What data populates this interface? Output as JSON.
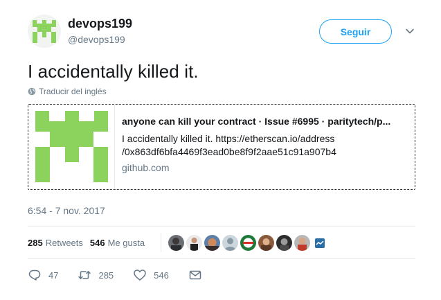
{
  "user": {
    "display_name": "devops199",
    "handle": "@devops199",
    "avatar_icon": "green-pixel-logo-icon"
  },
  "header": {
    "follow_label": "Seguir",
    "menu_icon": "chevron-down-icon"
  },
  "tweet": {
    "text": "I accidentally killed it.",
    "translate_label": "Traducir del inglés",
    "timestamp": "6:54 - 7 nov. 2017"
  },
  "card": {
    "title": "anyone can kill your contract · Issue #6995 · paritytech/p...",
    "description": "I accidentally killed it. https://etherscan.io/address /0x863df6bfa4469f3ead0be8f9f2aae51c91a907b4",
    "domain": "github.com",
    "thumbnail_icon": "green-pixel-logo-icon"
  },
  "stats": {
    "retweets_count": "285",
    "retweets_label": "Retweets",
    "likes_count": "546",
    "likes_label": "Me gusta"
  },
  "actions": {
    "reply_count": "47",
    "retweet_count": "285",
    "like_count": "546"
  },
  "colors": {
    "brand_blue": "#1da1f2",
    "logo_green": "#8cd35e",
    "muted_text": "#657786"
  }
}
